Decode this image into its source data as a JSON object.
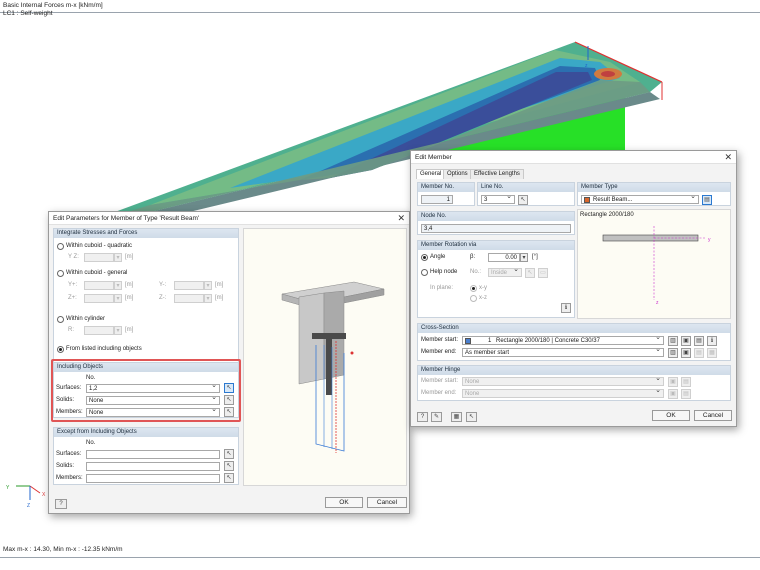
{
  "viewport": {
    "title_line1": "Basic Internal Forces m-x [kNm/m]",
    "title_line2": "LC1 : Self-weight",
    "status": "Max m-x : 14.30, Min m-x : -12.35 kNm/m",
    "axes": {
      "y": "Y",
      "x": "X",
      "z": "Z"
    }
  },
  "edit_params": {
    "title": "Edit Parameters for Member of Type 'Result Beam'",
    "integrate_header": "Integrate Stresses and Forces",
    "opt_cuboid_quadratic": "Within cuboid - quadratic",
    "yz_label": "Y Z:",
    "opt_cuboid_general": "Within cuboid - general",
    "y_plus": "Y+:",
    "y_minus": "Y-:",
    "z_plus": "Z+:",
    "z_minus": "Z-:",
    "opt_cylinder": "Within cylinder",
    "r_label": "R:",
    "unit_m": "[m]",
    "opt_listed": "From listed including objects",
    "including_header": "Including Objects",
    "no_label": "No.",
    "surfaces_label": "Surfaces:",
    "solids_label": "Solids:",
    "members_label": "Members:",
    "surfaces_value": "1,2",
    "solids_value": "None",
    "members_value": "None",
    "except_header": "Except from Including Objects",
    "ok": "OK",
    "cancel": "Cancel"
  },
  "edit_member": {
    "title": "Edit Member",
    "tabs": [
      "General",
      "Options",
      "Effective Lengths"
    ],
    "member_no_label": "Member No.",
    "member_no": "1",
    "line_no_label": "Line No.",
    "line_no": "3",
    "member_type_label": "Member Type",
    "member_type": "Result Beam...",
    "node_no_label": "Node No.",
    "node_no": "3,4",
    "section_preview_label": "Rectangle 2000/180",
    "rotation_header": "Member Rotation via",
    "angle_label": "Angle",
    "beta_label": "β:",
    "beta_value": "0.00",
    "deg_unit": "[°]",
    "help_node_label": "Help node",
    "help_no_label": "No.:",
    "help_inside": "Inside",
    "in_plane_label": "In plane:",
    "plane_xy": "x-y",
    "plane_xz": "x-z",
    "cross_section_header": "Cross-Section",
    "member_start_label": "Member start:",
    "member_end_label": "Member end:",
    "cs_number": "1",
    "cs_value": "Rectangle 2000/180 | Concrete C30/37",
    "cs_end_value": "As member start",
    "hinge_header": "Member Hinge",
    "hinge_start_label": "Member start:",
    "hinge_end_label": "Member end:",
    "hinge_start_value": "None",
    "hinge_end_value": "None",
    "ok": "OK",
    "cancel": "Cancel",
    "member_type_color": "#d9662b"
  }
}
